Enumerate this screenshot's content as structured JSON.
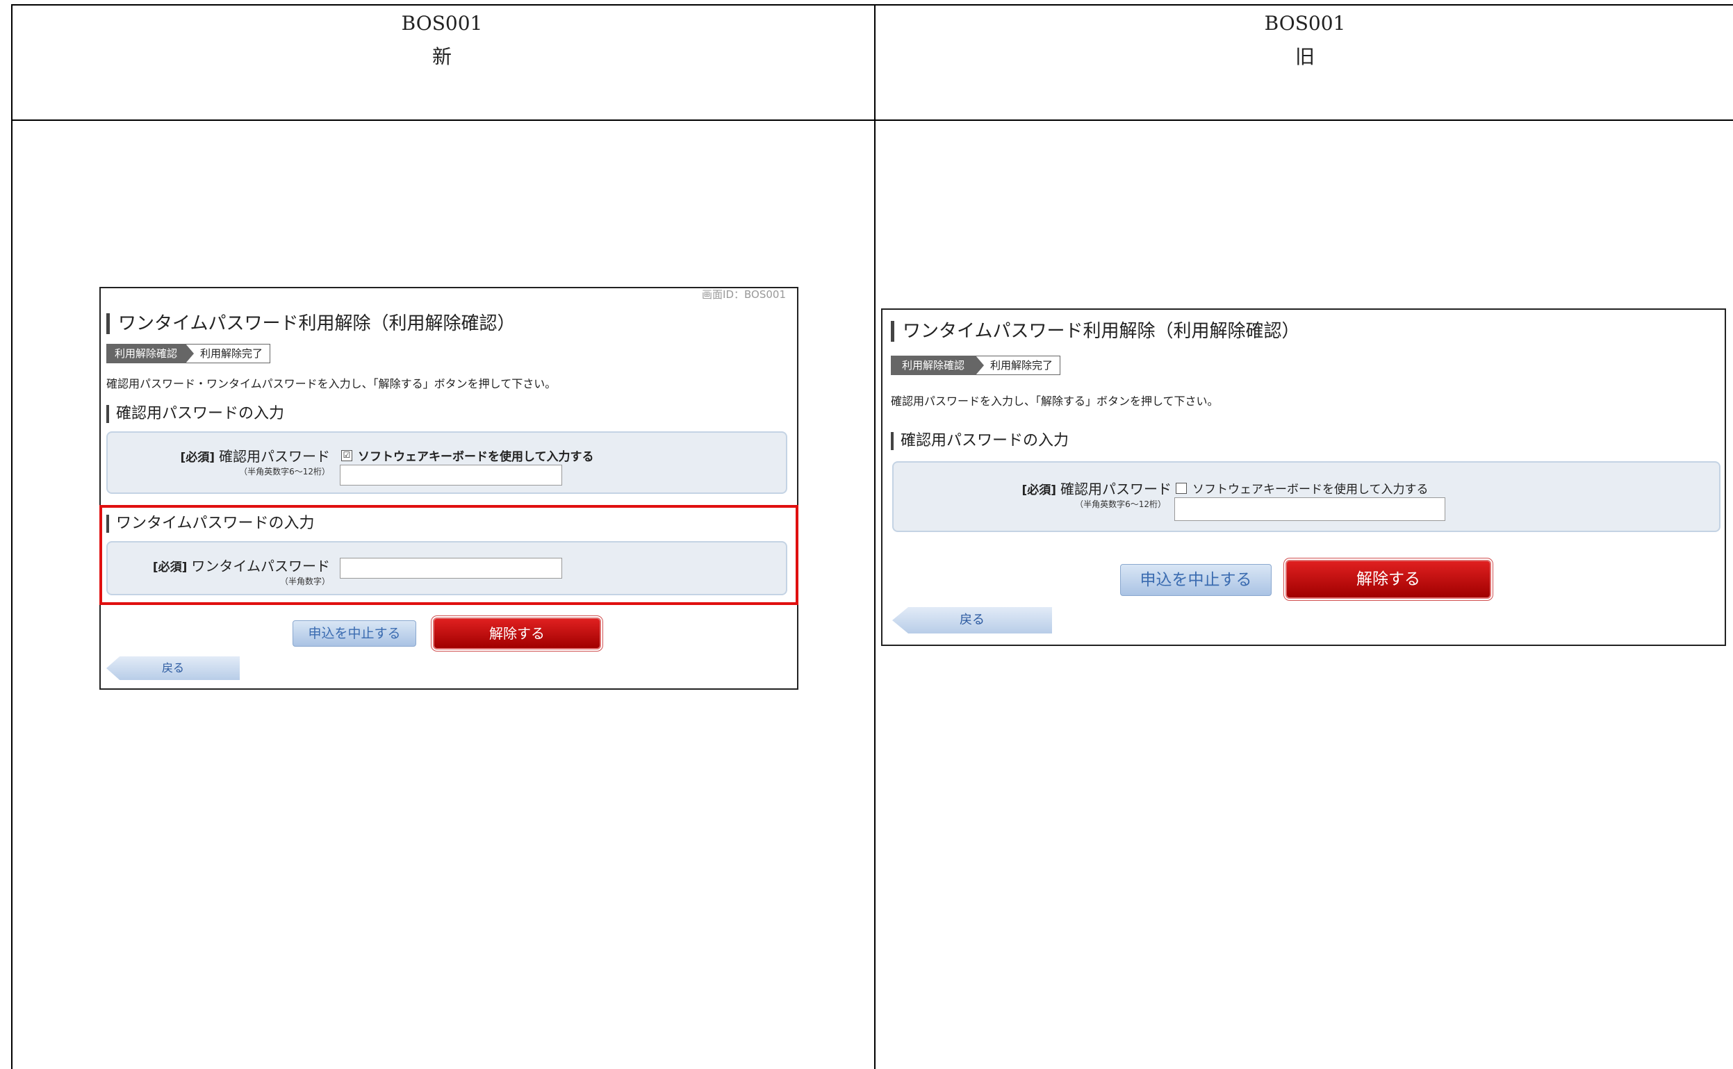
{
  "headers": {
    "left": {
      "id": "BOS001",
      "label": "新"
    },
    "right": {
      "id": "BOS001",
      "label": "旧"
    }
  },
  "new_screen": {
    "screen_id": "画面ID：BOS001",
    "title": "ワンタイムパスワード利用解除（利用解除確認）",
    "step_active": "利用解除確認",
    "step_next": "利用解除完了",
    "description": "確認用パスワード・ワンタイムパスワードを入力し、「解除する」ボタンを押して下さい。",
    "section_password": "確認用パスワードの入力",
    "required": "[必須]",
    "password_label": "確認用パスワード",
    "password_hint": "（半角英数字6～12桁）",
    "software_keyboard_label": "ソフトウェアキーボードを使用して入力する",
    "software_keyboard_checked": "☑",
    "password_value": "",
    "section_otp": "ワンタイムパスワードの入力",
    "otp_label": "ワンタイムパスワード",
    "otp_hint": "（半角数字）",
    "otp_value": "",
    "cancel_button": "申込を中止する",
    "release_button": "解除する",
    "back_button": "戻る"
  },
  "old_screen": {
    "title": "ワンタイムパスワード利用解除（利用解除確認）",
    "step_active": "利用解除確認",
    "step_next": "利用解除完了",
    "description": "確認用パスワードを入力し、「解除する」ボタンを押して下さい。",
    "section_password": "確認用パスワードの入力",
    "required": "[必須]",
    "password_label": "確認用パスワード",
    "password_hint": "（半角英数字6～12桁）",
    "software_keyboard_label": "ソフトウェアキーボードを使用して入力する",
    "software_keyboard_checked": "",
    "password_value": "",
    "cancel_button": "申込を中止する",
    "release_button": "解除する",
    "back_button": "戻る"
  },
  "colors": {
    "highlight": "#e01010",
    "release": "#c00000",
    "panel": "#e8edf3"
  }
}
